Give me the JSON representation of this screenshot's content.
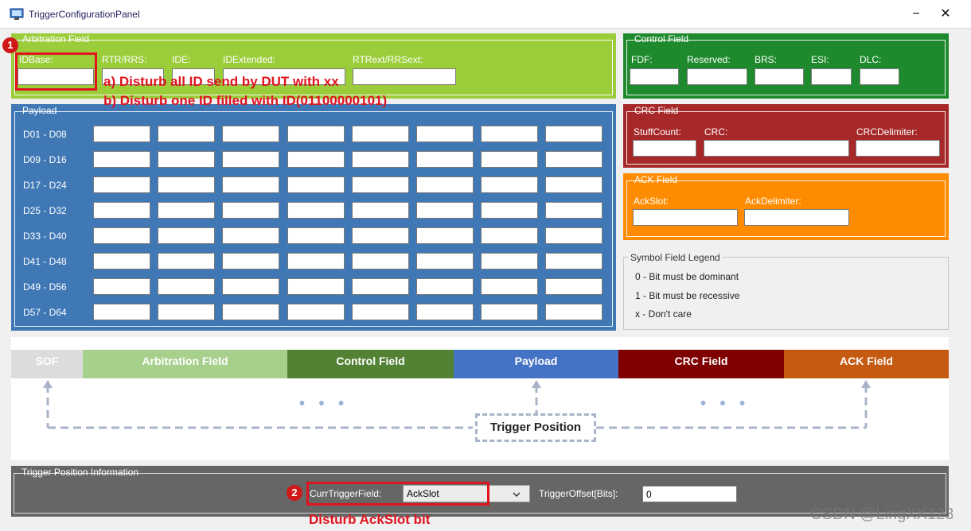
{
  "window": {
    "title": "TriggerConfigurationPanel",
    "minimize_glyph": "−",
    "close_glyph": "✕"
  },
  "arbitration": {
    "title": "Arbitration Field",
    "idbase_label": "IDBase:",
    "rtr_label": "RTR/RRS:",
    "ide_label": "IDE:",
    "idextended_label": "IDExtended:",
    "rtrext_label": "RTRext/RRSext:",
    "idbase_value": "",
    "rtr_value": "",
    "ide_value": "",
    "idextended_value": "",
    "rtrext_value": ""
  },
  "control": {
    "title": "Control Field",
    "fdf_label": "FDF:",
    "reserved_label": "Reserved:",
    "brs_label": "BRS:",
    "esi_label": "ESI:",
    "dlc_label": "DLC:"
  },
  "payload": {
    "title": "Payload",
    "rows": [
      "D01 - D08",
      "D09 - D16",
      "D17 - D24",
      "D25 - D32",
      "D33 - D40",
      "D41 - D48",
      "D49 - D56",
      "D57 - D64"
    ]
  },
  "crc": {
    "title": "CRC Field",
    "stuffcount_label": "StuffCount:",
    "crc_label": "CRC:",
    "crcdelim_label": "CRCDelimiter:"
  },
  "ack": {
    "title": "ACK Field",
    "ackslot_label": "AckSlot:",
    "ackdelim_label": "AckDelimiter:"
  },
  "legend": {
    "title": "Symbol Field Legend",
    "items": [
      "0 - Bit must be dominant",
      "1 - Bit must be recessive",
      "x - Don't care"
    ]
  },
  "frame": {
    "segments": [
      "SOF",
      "Arbitration Field",
      "Control Field",
      "Payload",
      "CRC Field",
      "ACK Field"
    ],
    "trigger_position_label": "Trigger Position",
    "dots": "• • •"
  },
  "trigger_info": {
    "title": "Trigger Position Information",
    "curr_field_label": "CurrTriggerField:",
    "curr_field_value": "AckSlot",
    "offset_label": "TriggerOffset[Bits]:",
    "offset_value": "0"
  },
  "annotations": {
    "badge1": "1",
    "badge2": "2",
    "note_a": "a) Disturb all ID send by DUT with xx",
    "note_b": "b) Disturb one ID filled with ID(01100000101)",
    "note_ack": "Disturb AckSlot bit"
  },
  "watermark": "CSDN @LingXX123",
  "colors": {
    "arbitration": "#9bcd3a",
    "control": "#1e8a2d",
    "payload": "#3f78b5",
    "crc": "#a62828",
    "ack": "#ff8c00",
    "trigger_info": "#666666",
    "seg_sof": "#dcdcdc",
    "seg_arbitration": "#a8d08d",
    "seg_control": "#548235",
    "seg_payload": "#4472c4",
    "seg_crc": "#7f0000",
    "seg_ack": "#c55a11"
  }
}
